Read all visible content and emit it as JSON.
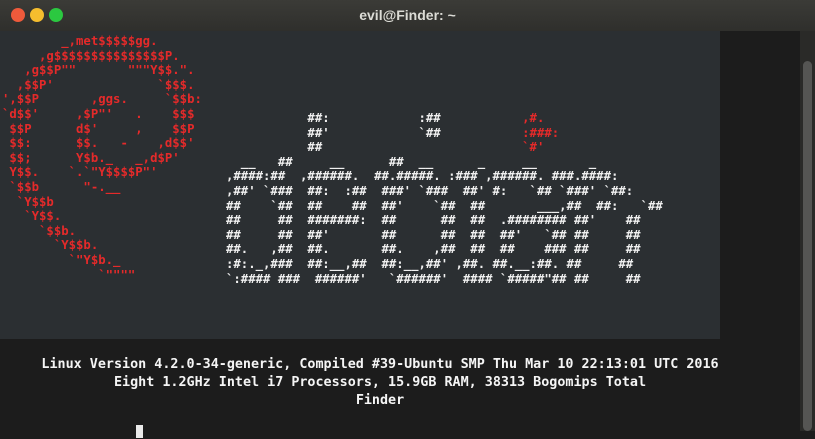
{
  "window": {
    "title": "evil@Finder: ~",
    "buttons": [
      "close",
      "minimize",
      "maximize"
    ],
    "colors": {
      "close": "#ee5a3b",
      "minimize": "#f5bd2e",
      "maximize": "#2bc840"
    }
  },
  "terminal": {
    "logo_art": "        _,met$$$$$gg.\n     ,g$$$$$$$$$$$$$$$P.\n   ,g$$P\"\"       \"\"\"Y$$.\".\n  ,$$P'              `$$$.\n',$$P       ,ggs.     `$$b:\n`d$$'     ,$P\"'   .    $$$\n $$P      d$'     ,    $$P\n $$:      $$.   -    ,d$$'\n $$;      Y$b._   _,d$P'\n Y$$.    `.`\"Y$$$$P\"'\n `$$b      \"-.__\n  `Y$$b\n   `Y$$.\n     `$$b.\n       `Y$$b.\n         `\"Y$b._\n             `\"\"\"\"",
    "wordmark_art": "           ##:            :##           ,#.\n           ##'            `##           :###:\n           ##                           `#'\n  __   ##     __      ##  __      _     __       _\n,####:##  ,######.  ##.#####. :### ,######. ###.####:\n,##' `###  ##:  :##  ###' `###  ##' #:   `## `###' `##:\n##    `##  ##    ##  ##'    `##  ##       ___,##  ##:   `##\n##     ##  #######:  ##      ##  ##  .######## ##'    ##\n##     ##  ##'       ##      ##  ##  ##'   `## ##     ##\n##.   ,##  ##.       ##.    ,##  ##  ##    ### ##     ##\n:#:._,###  ##:__,##  ##:__,##' ,##. ##.__:##. ##     ##\n`:#### ###  ######'   `######'  #### `#####\"## ##     ##",
    "info_lines": [
      "Linux Version 4.2.0-34-generic, Compiled #39-Ubuntu SMP Thu Mar 10 22:13:01 UTC 2016",
      "Eight 1.2GHz Intel i7 Processors, 15.9GB RAM, 38313 Bogomips Total",
      "Finder"
    ],
    "colors": {
      "logo": "#e52a2a",
      "text": "#f0f0f0",
      "background": "#1c1c1c",
      "art_background": "#2b2f32"
    }
  }
}
